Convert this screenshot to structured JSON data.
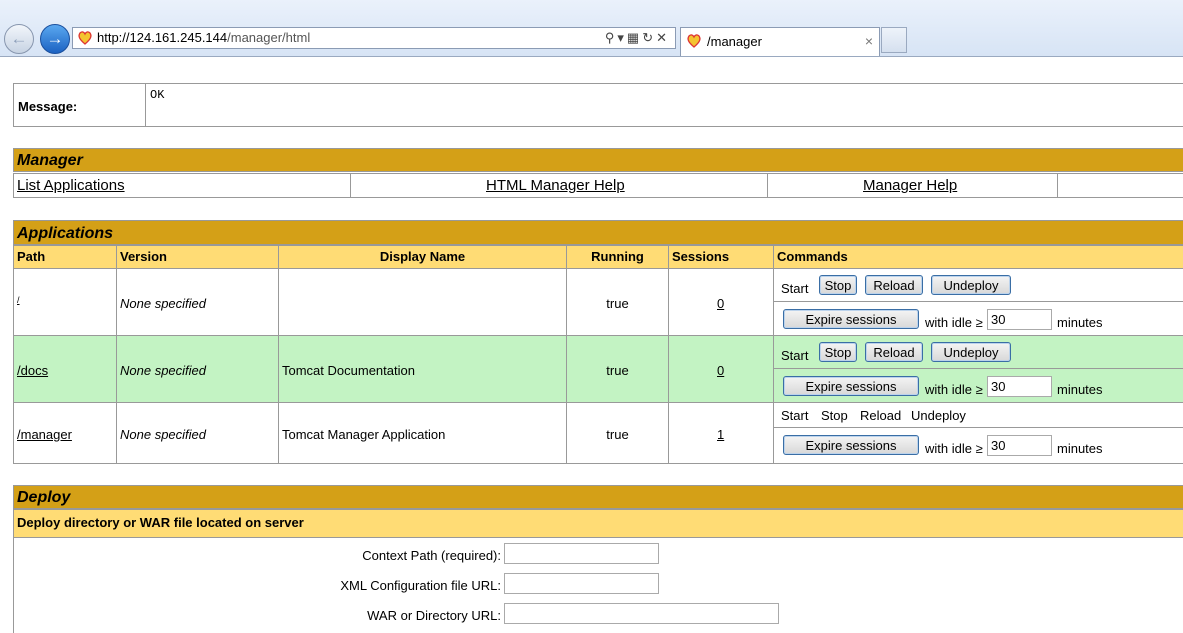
{
  "browser": {
    "url_host": "http://124.161.245.144",
    "url_path": "/manager/html",
    "tab_title": "/manager",
    "close_glyph": "×"
  },
  "message": {
    "label": "Message:",
    "value": "OK"
  },
  "manager": {
    "title": "Manager",
    "links": [
      "List Applications",
      "HTML Manager Help",
      "Manager Help"
    ]
  },
  "applications": {
    "title": "Applications",
    "headers": {
      "path": "Path",
      "version": "Version",
      "display_name": "Display Name",
      "running": "Running",
      "sessions": "Sessions",
      "commands": "Commands"
    },
    "rows": [
      {
        "path": "/",
        "version": "None specified",
        "display_name": "",
        "running": "true",
        "sessions": "0",
        "highlight": false,
        "start_enabled": false
      },
      {
        "path": "/docs",
        "version": "None specified",
        "display_name": "Tomcat Documentation",
        "running": "true",
        "sessions": "0",
        "highlight": true,
        "start_enabled": false
      },
      {
        "path": "/manager",
        "version": "None specified",
        "display_name": "Tomcat Manager Application",
        "running": "true",
        "sessions": "1",
        "highlight": false,
        "start_enabled": false
      }
    ],
    "commands": {
      "start": "Start",
      "stop": "Stop",
      "reload": "Reload",
      "undeploy": "Undeploy",
      "expire": "Expire sessions",
      "with_idle": "with idle ≥",
      "idle_value": "30",
      "minutes": "minutes"
    }
  },
  "deploy": {
    "title": "Deploy",
    "subtitle": "Deploy directory or WAR file located on server",
    "fields": [
      "Context Path (required):",
      "XML Configuration file URL:",
      "WAR or Directory URL:"
    ]
  },
  "colors": {
    "section_bar": "#d4a017",
    "header_bar": "#ffdc75",
    "highlight_row": "#c3f3c3"
  }
}
